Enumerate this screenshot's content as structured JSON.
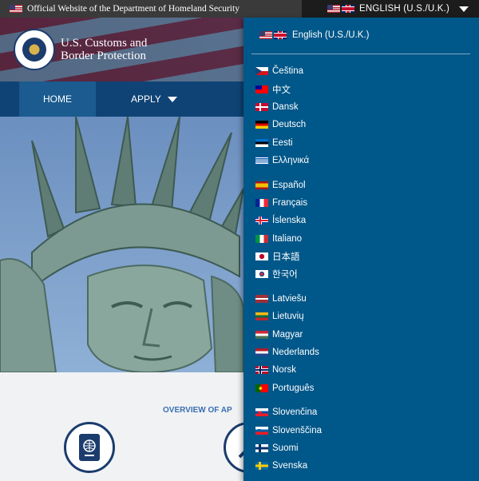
{
  "topbar": {
    "official_text": "Official Website of the Department of Homeland Security",
    "language_label": "ENGLISH (U.S./U.K.)",
    "icons": [
      "us-flag-icon",
      "uk-flag-icon",
      "caret-down-icon"
    ]
  },
  "header": {
    "agency_line1": "U.S. Customs and",
    "agency_line2": "Border Protection"
  },
  "nav": {
    "home_label": "HOME",
    "apply_label": "APPLY"
  },
  "overview": {
    "title": "OVERVIEW OF AP"
  },
  "dropdown": {
    "current_label": "English (U.S./U.K.)",
    "languages": [
      {
        "name": "Čeština",
        "colors": [
          "#ffffff",
          "#d7141a",
          "#11457e"
        ]
      },
      {
        "name": "中文",
        "colors": [
          "#fe0000",
          "#000095"
        ]
      },
      {
        "name": "Dansk",
        "colors": [
          "#c60c30",
          "#ffffff"
        ]
      },
      {
        "name": "Deutsch",
        "colors": [
          "#000000",
          "#dd0000",
          "#ffce00"
        ]
      },
      {
        "name": "Eesti",
        "colors": [
          "#0072ce",
          "#000000",
          "#ffffff"
        ]
      },
      {
        "name": "Ελληνικά",
        "colors": [
          "#0d5eaf",
          "#ffffff"
        ]
      },
      {
        "name": "Español",
        "colors": [
          "#aa151b",
          "#f1bf00"
        ]
      },
      {
        "name": "Français",
        "colors": [
          "#002395",
          "#ffffff",
          "#ed2939"
        ]
      },
      {
        "name": "Íslenska",
        "colors": [
          "#02529c",
          "#dc1e35",
          "#ffffff"
        ]
      },
      {
        "name": "Italiano",
        "colors": [
          "#009246",
          "#ffffff",
          "#ce2b37"
        ]
      },
      {
        "name": "日本語",
        "colors": [
          "#ffffff",
          "#bc002d"
        ]
      },
      {
        "name": "한국어",
        "colors": [
          "#ffffff",
          "#cd2e3a",
          "#0047a0"
        ]
      },
      {
        "name": "Latviešu",
        "colors": [
          "#9e3039",
          "#ffffff"
        ]
      },
      {
        "name": "Lietuvių",
        "colors": [
          "#fdb913",
          "#006a44",
          "#c1272d"
        ]
      },
      {
        "name": "Magyar",
        "colors": [
          "#ce2939",
          "#ffffff",
          "#477050"
        ]
      },
      {
        "name": "Nederlands",
        "colors": [
          "#ae1c28",
          "#ffffff",
          "#21468b"
        ]
      },
      {
        "name": "Norsk",
        "colors": [
          "#ba0c2f",
          "#00205b",
          "#ffffff"
        ]
      },
      {
        "name": "Português",
        "colors": [
          "#006600",
          "#ff0000"
        ]
      },
      {
        "name": "Slovenčina",
        "colors": [
          "#ffffff",
          "#0b4ea2",
          "#ee1c25"
        ]
      },
      {
        "name": "Slovenščina",
        "colors": [
          "#ffffff",
          "#005da4",
          "#ed1c24"
        ]
      },
      {
        "name": "Suomi",
        "colors": [
          "#ffffff",
          "#002f6c"
        ]
      },
      {
        "name": "Svenska",
        "colors": [
          "#006aa7",
          "#fecc00"
        ]
      }
    ]
  },
  "colors": {
    "dropdown_bg": "#005789",
    "nav_bg": "#0f4375",
    "home_bg": "#1b5b8f",
    "topbar_bg": "#1c1c1c",
    "overview_title": "#3b6fb2"
  }
}
